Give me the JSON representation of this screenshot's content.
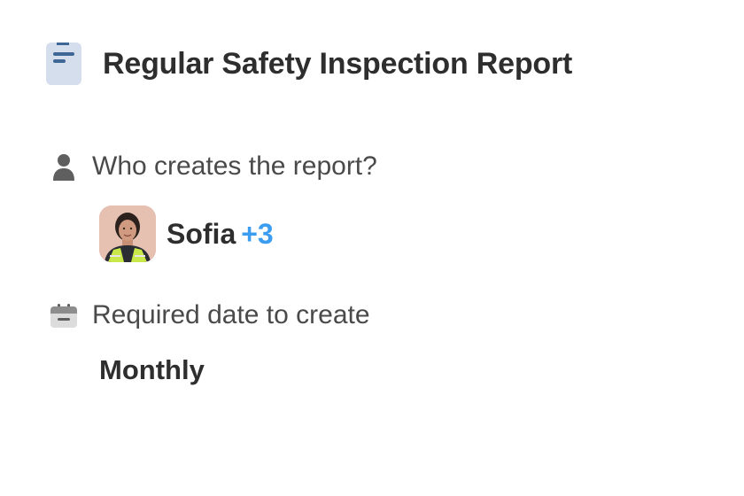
{
  "document": {
    "icon": "document-icon",
    "title": "Regular Safety Inspection Report"
  },
  "fields": {
    "creator": {
      "icon": "person-icon",
      "label": "Who creates the report?",
      "owner_name": "Sofia",
      "others_count": "+3"
    },
    "schedule": {
      "icon": "calendar-icon",
      "label": "Required date to create",
      "value": "Monthly"
    }
  },
  "colors": {
    "accent": "#3b9cf0",
    "icon_gray": "#5f5f5f",
    "doc_icon_bg": "#d4deec",
    "doc_icon_lines": "#3f6796"
  }
}
